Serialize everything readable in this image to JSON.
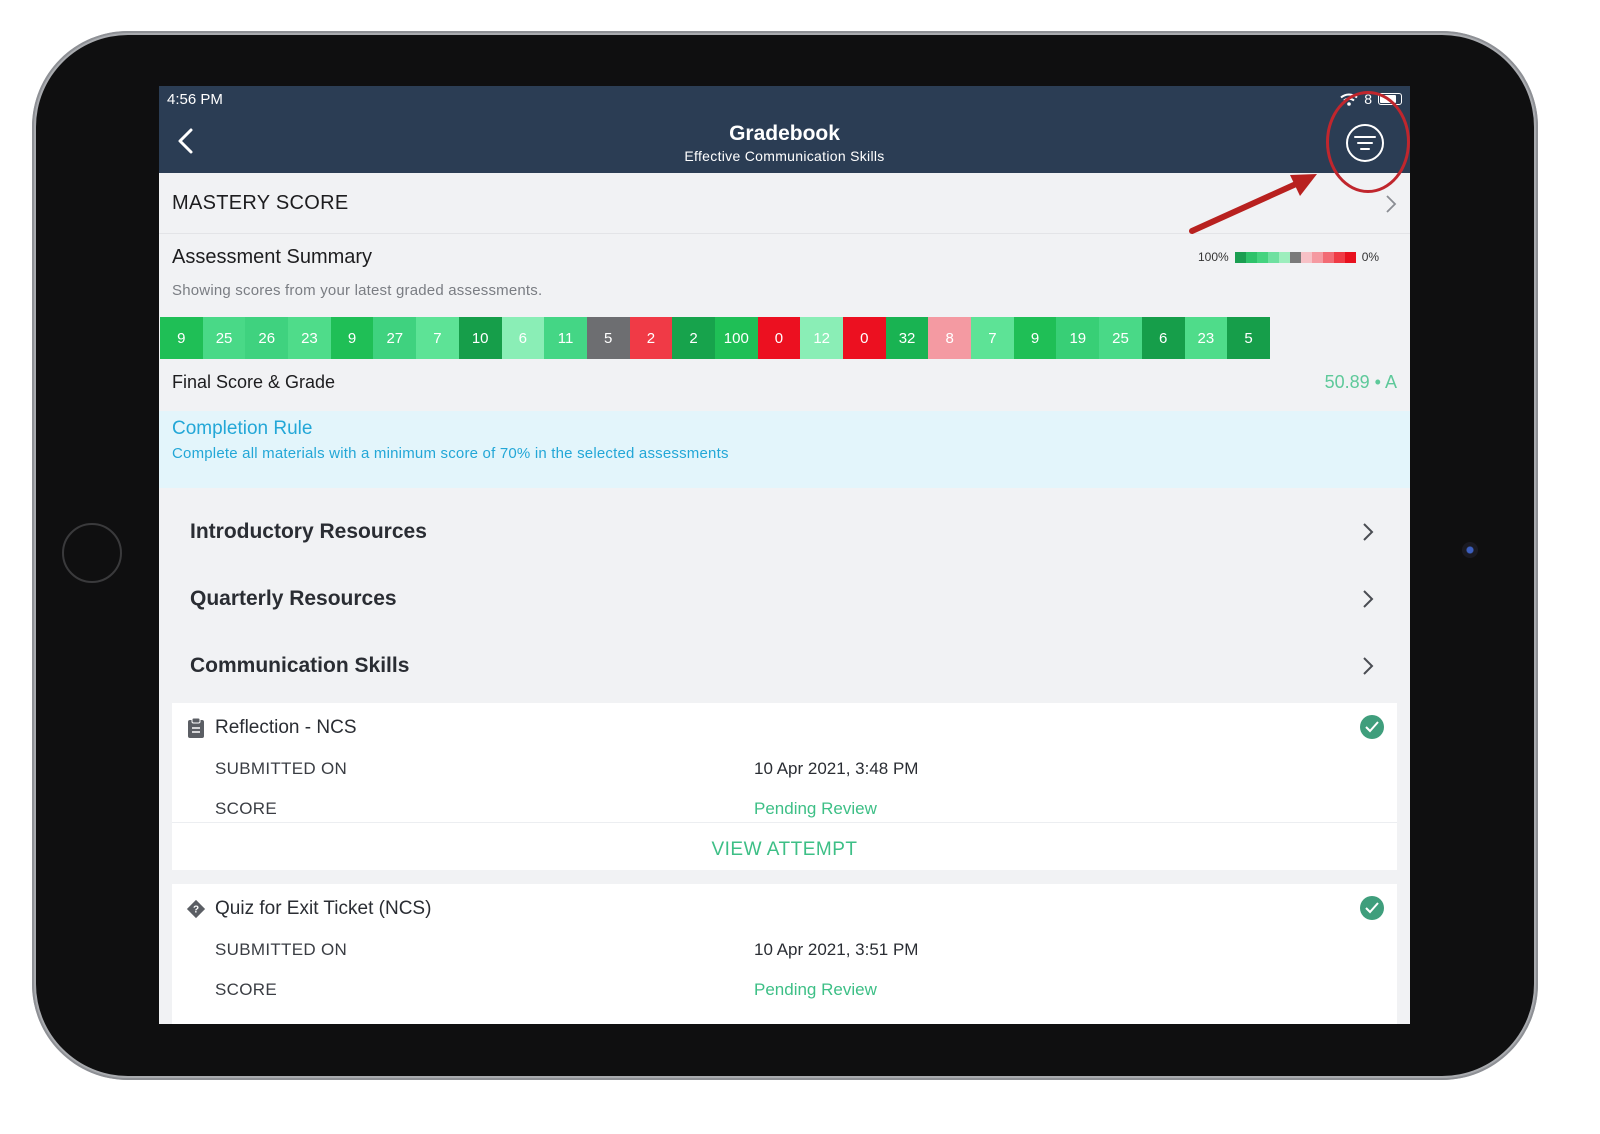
{
  "status_bar": {
    "time": "4:56 PM",
    "battery": "8"
  },
  "header": {
    "title": "Gradebook",
    "subtitle": "Effective Communication Skills"
  },
  "mastery": {
    "label": "MASTERY SCORE"
  },
  "summary": {
    "title": "Assessment Summary",
    "description": "Showing scores from your latest graded assessments.",
    "legend_high": "100%",
    "legend_low": "0%",
    "legend_colors": [
      "#1b9e51",
      "#2ec26a",
      "#45d37f",
      "#6fe0a0",
      "#9deebd",
      "#7a7a7a",
      "#f7c1c6",
      "#f59aa1",
      "#f26b74",
      "#ef3b45",
      "#e8111e"
    ]
  },
  "scores": [
    {
      "value": "9",
      "color": "#1fbf56"
    },
    {
      "value": "25",
      "color": "#49d987"
    },
    {
      "value": "26",
      "color": "#3fd27f"
    },
    {
      "value": "23",
      "color": "#4fdc8a"
    },
    {
      "value": "9",
      "color": "#1fbf56"
    },
    {
      "value": "27",
      "color": "#3fd27f"
    },
    {
      "value": "7",
      "color": "#5de396"
    },
    {
      "value": "10",
      "color": "#169e4a"
    },
    {
      "value": "6",
      "color": "#8aeeb6"
    },
    {
      "value": "11",
      "color": "#44d685"
    },
    {
      "value": "5",
      "color": "#6d6e71"
    },
    {
      "value": "2",
      "color": "#f03a46"
    },
    {
      "value": "2",
      "color": "#17a34c"
    },
    {
      "value": "100",
      "color": "#1fbf56"
    },
    {
      "value": "0",
      "color": "#ec1020"
    },
    {
      "value": "12",
      "color": "#8aeeb6"
    },
    {
      "value": "0",
      "color": "#ec1020"
    },
    {
      "value": "32",
      "color": "#19b352"
    },
    {
      "value": "8",
      "color": "#f49aa2"
    },
    {
      "value": "7",
      "color": "#5de396"
    },
    {
      "value": "9",
      "color": "#1fbf56"
    },
    {
      "value": "19",
      "color": "#38cf76"
    },
    {
      "value": "25",
      "color": "#49d987"
    },
    {
      "value": "6",
      "color": "#169e4a"
    },
    {
      "value": "23",
      "color": "#4fdc8a"
    },
    {
      "value": "5",
      "color": "#169e4a"
    }
  ],
  "final": {
    "label": "Final Score & Grade",
    "value": "50.89 • A"
  },
  "completion_rule": {
    "title": "Completion Rule",
    "text": "Complete all materials with a minimum score of 70% in the selected assessments"
  },
  "sections": [
    {
      "label": "Introductory Resources"
    },
    {
      "label": "Quarterly Resources"
    },
    {
      "label": "Communication Skills"
    }
  ],
  "items": [
    {
      "title": "Reflection - NCS",
      "icon": "clipboard-icon",
      "submitted_label": "SUBMITTED ON",
      "submitted_value": "10 Apr 2021, 3:48 PM",
      "score_label": "SCORE",
      "score_value": "Pending Review",
      "action": "VIEW ATTEMPT"
    },
    {
      "title": "Quiz for Exit Ticket (NCS)",
      "icon": "quiz-diamond-icon",
      "submitted_label": "SUBMITTED ON",
      "submitted_value": "10 Apr 2021, 3:51 PM",
      "score_label": "SCORE",
      "score_value": "Pending Review"
    }
  ]
}
